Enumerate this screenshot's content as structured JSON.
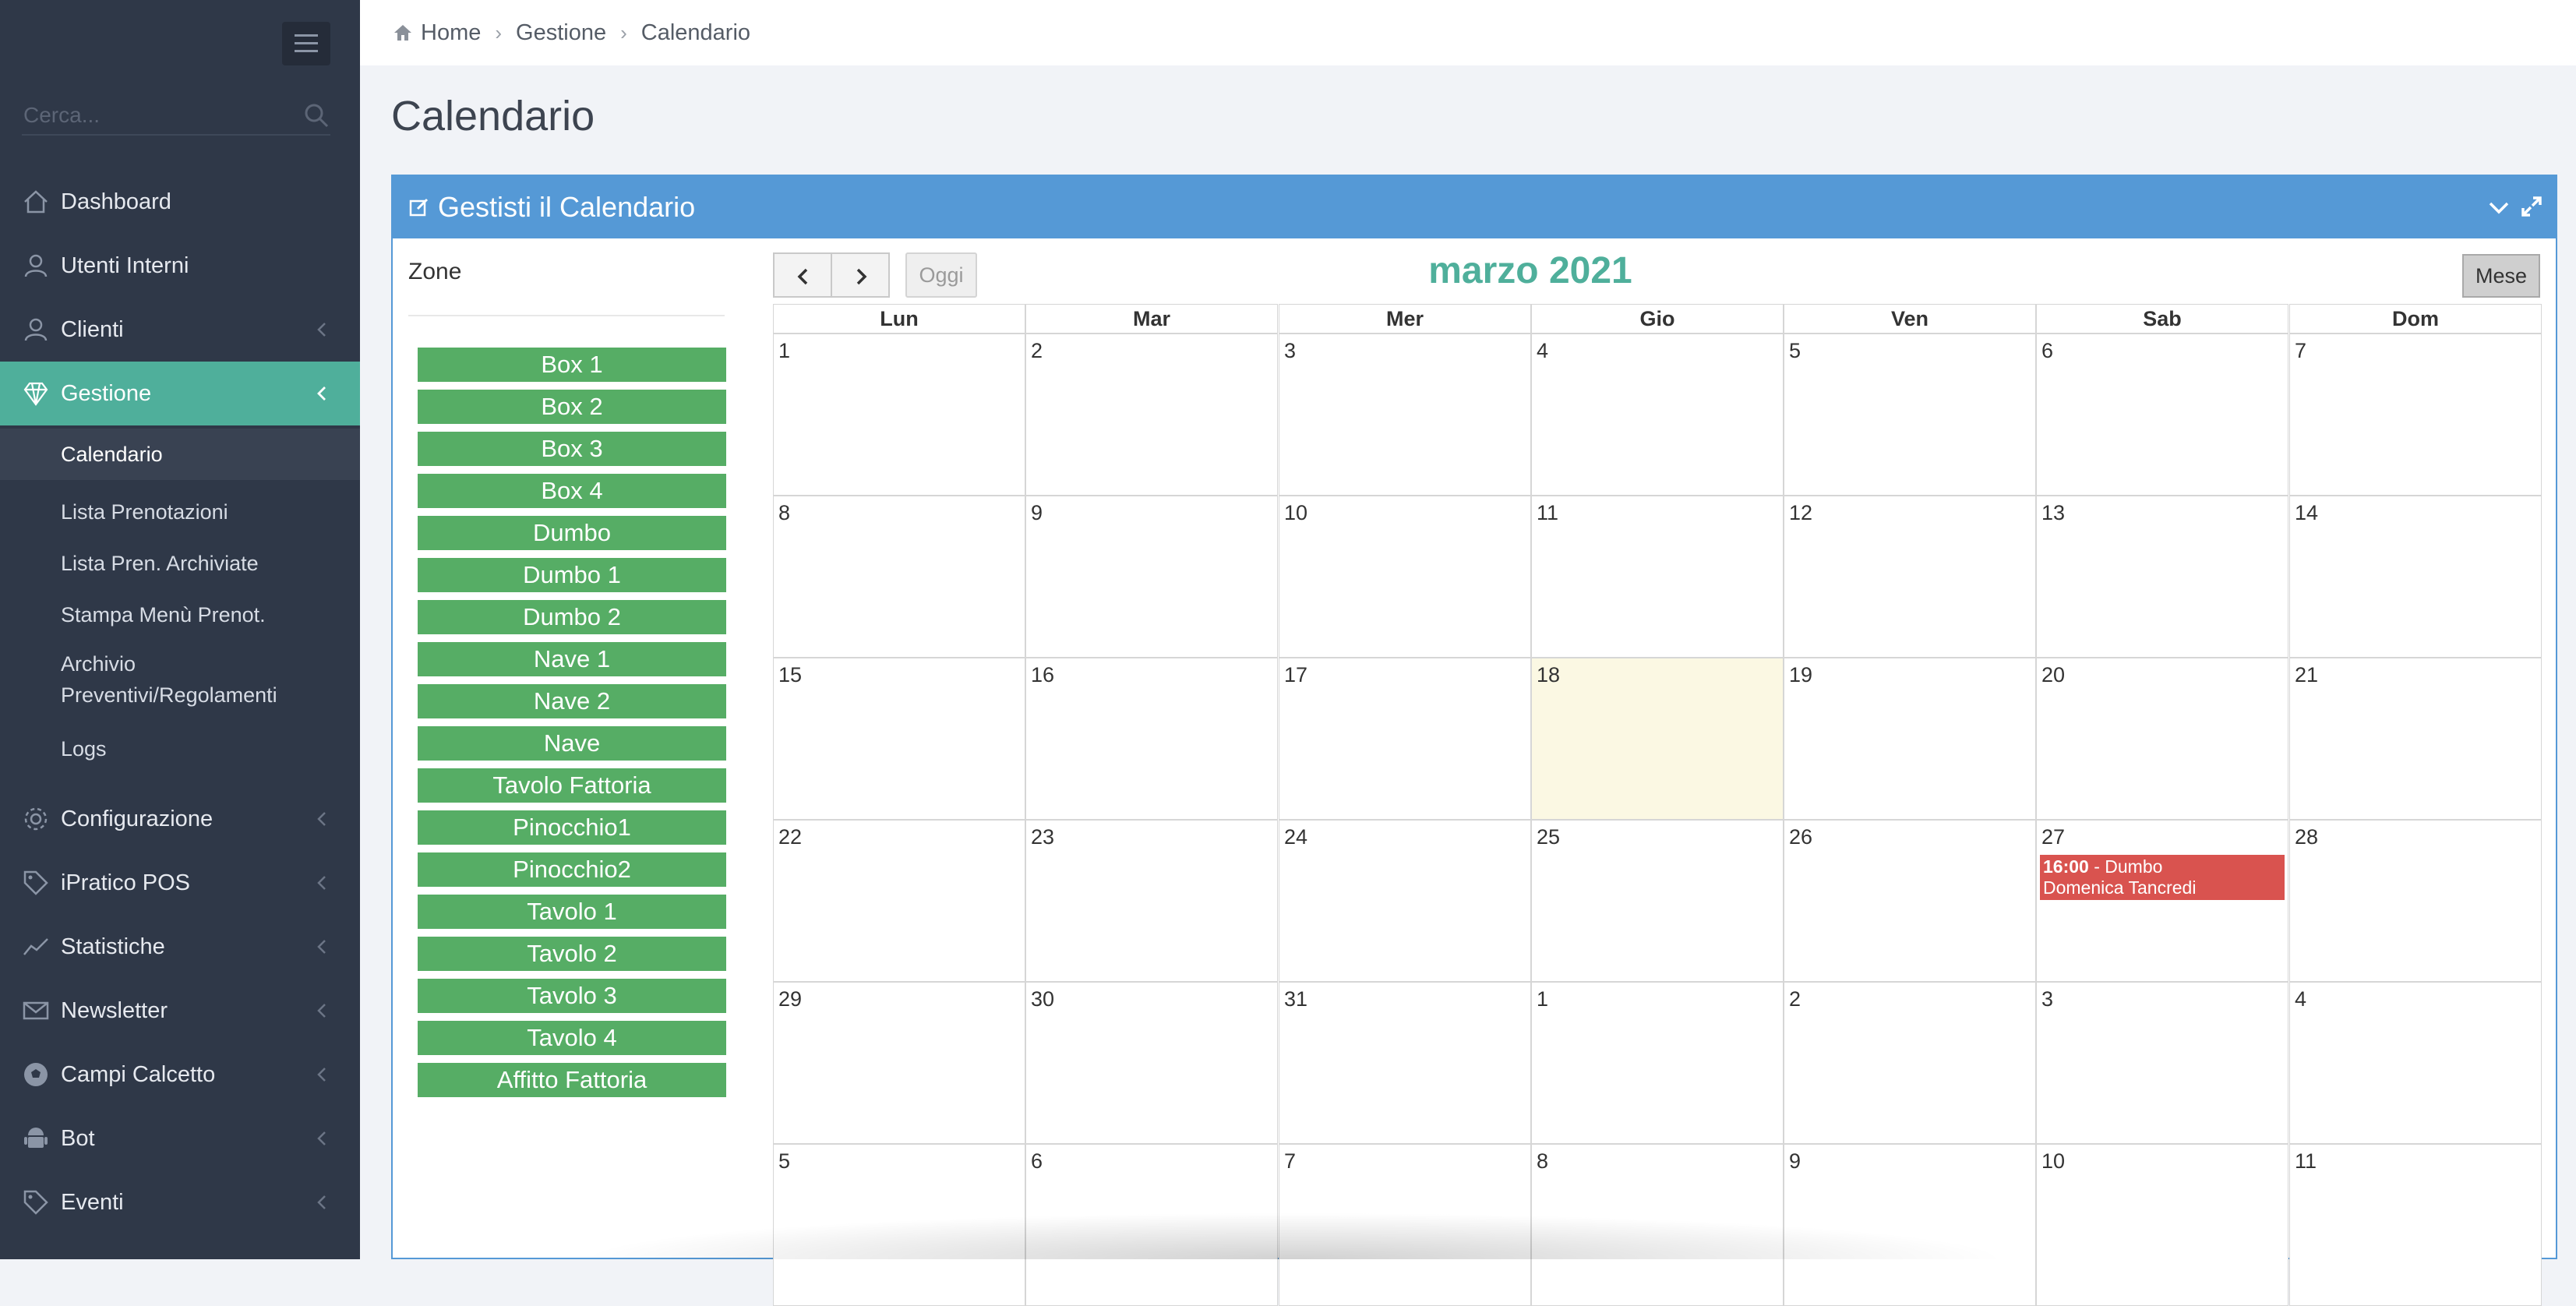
{
  "sidebar": {
    "search_placeholder": "Cerca...",
    "items": [
      {
        "label": "Dashboard",
        "icon": "home-icon"
      },
      {
        "label": "Utenti Interni",
        "icon": "user-icon"
      },
      {
        "label": "Clienti",
        "icon": "user-icon"
      },
      {
        "label": "Gestione",
        "icon": "diamond-icon",
        "active": true
      },
      {
        "label": "Configurazione",
        "icon": "gear-icon"
      },
      {
        "label": "iPratico POS",
        "icon": "tag-icon"
      },
      {
        "label": "Statistiche",
        "icon": "chart-line-icon"
      },
      {
        "label": "Newsletter",
        "icon": "envelope-icon"
      },
      {
        "label": "Campi Calcetto",
        "icon": "soccer-ball-icon"
      },
      {
        "label": "Bot",
        "icon": "android-icon"
      },
      {
        "label": "Eventi",
        "icon": "tag-icon"
      }
    ],
    "submenu": [
      {
        "label": "Calendario",
        "current": true
      },
      {
        "label": "Lista Prenotazioni"
      },
      {
        "label": "Lista Pren. Archiviate"
      },
      {
        "label": "Stampa Menù Prenot."
      },
      {
        "label": "Archivio"
      },
      {
        "label": "Preventivi/Regolamenti"
      },
      {
        "label": "Logs"
      }
    ]
  },
  "breadcrumb": [
    "Home",
    "Gestione",
    "Calendario"
  ],
  "page_title": "Calendario",
  "panel": {
    "title": "Gestisti il Calendario",
    "zones_label": "Zone",
    "zones": [
      "Box 1",
      "Box 2",
      "Box 3",
      "Box 4",
      "Dumbo",
      "Dumbo 1",
      "Dumbo 2",
      "Nave 1",
      "Nave 2",
      "Nave",
      "Tavolo Fattoria",
      "Pinocchio1",
      "Pinocchio2",
      "Tavolo 1",
      "Tavolo 2",
      "Tavolo 3",
      "Tavolo 4",
      "Affitto Fattoria"
    ]
  },
  "calendar": {
    "today_label": "Oggi",
    "month_title": "marzo 2021",
    "view_label": "Mese",
    "weekdays": [
      "Lun",
      "Mar",
      "Mer",
      "Gio",
      "Ven",
      "Sab",
      "Dom"
    ],
    "weeks": [
      [
        "1",
        "2",
        "3",
        "4",
        "5",
        "6",
        "7"
      ],
      [
        "8",
        "9",
        "10",
        "11",
        "12",
        "13",
        "14"
      ],
      [
        "15",
        "16",
        "17",
        "18",
        "19",
        "20",
        "21"
      ],
      [
        "22",
        "23",
        "24",
        "25",
        "26",
        "27",
        "28"
      ],
      [
        "29",
        "30",
        "31",
        "1",
        "2",
        "3",
        "4"
      ],
      [
        "5",
        "6",
        "7",
        "8",
        "9",
        "10",
        "11"
      ]
    ],
    "today": {
      "week": 2,
      "day": 3
    },
    "event": {
      "week": 3,
      "day": 5,
      "time": "16:00",
      "title": " - Dumbo",
      "subtitle": "Domenica Tancredi",
      "color": "#d9534f"
    }
  },
  "colors": {
    "sidebar_bg": "#2f3848",
    "accent": "#4faf9b",
    "panel_header": "#5599d6",
    "zone_button": "#56ad65"
  }
}
